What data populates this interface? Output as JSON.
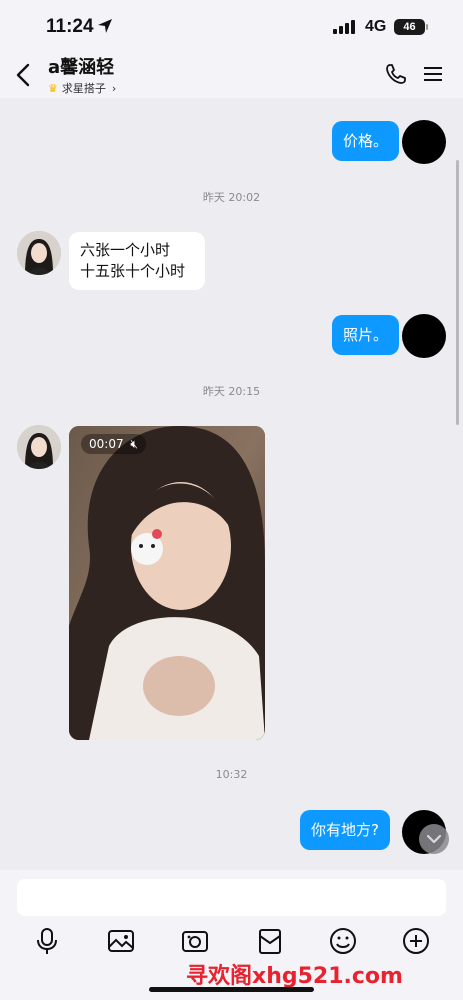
{
  "status": {
    "time": "11:24",
    "network": "4G",
    "battery": "46"
  },
  "header": {
    "name": "a馨涵轻",
    "subtitle": "求星搭子"
  },
  "messages": {
    "m1": "价格。",
    "ts1": "昨天 20:02",
    "m2_line1": "六张一个小时",
    "m2_line2": "十五张十个小时",
    "m3": "照片。",
    "ts2": "昨天 20:15",
    "video_duration": "00:07",
    "ts3": "10:32",
    "m4": "你有地方?"
  },
  "input": {
    "placeholder": ""
  },
  "watermark": "寻欢阁xhg521.com",
  "colors": {
    "accent": "#0d99ff",
    "background": "#ececf1",
    "watermark": "#e8232f"
  }
}
